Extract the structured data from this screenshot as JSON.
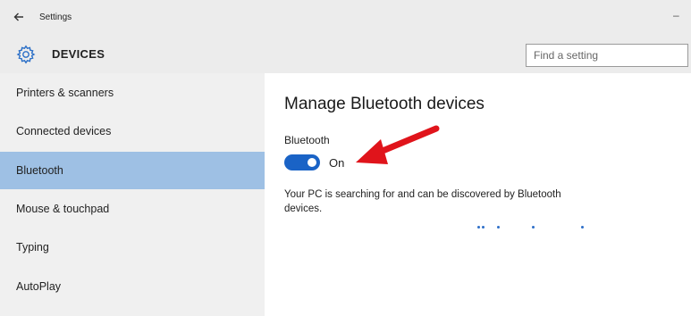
{
  "window": {
    "title": "Settings",
    "minimize_label": "–",
    "back_icon": "back-arrow-icon"
  },
  "header": {
    "section_title": "DEVICES",
    "gear_icon": "gear-icon",
    "search": {
      "placeholder": "Find a setting",
      "value": ""
    }
  },
  "sidebar": {
    "items": [
      {
        "label": "Printers & scanners",
        "selected": false
      },
      {
        "label": "Connected devices",
        "selected": false
      },
      {
        "label": "Bluetooth",
        "selected": true
      },
      {
        "label": "Mouse & touchpad",
        "selected": false
      },
      {
        "label": "Typing",
        "selected": false
      },
      {
        "label": "AutoPlay",
        "selected": false
      }
    ],
    "selected_color": "#9ec0e4"
  },
  "main": {
    "heading": "Manage Bluetooth devices",
    "bluetooth_label": "Bluetooth",
    "toggle": {
      "state": "On",
      "on": true,
      "color": "#1a63c6"
    },
    "status_line_1": "Your PC is searching for and can be discovered by Bluetooth",
    "status_line_2": "devices.",
    "searching_indicator": "progress-dots",
    "annotation": {
      "icon": "red-arrow-icon",
      "color": "#e0141b"
    }
  }
}
